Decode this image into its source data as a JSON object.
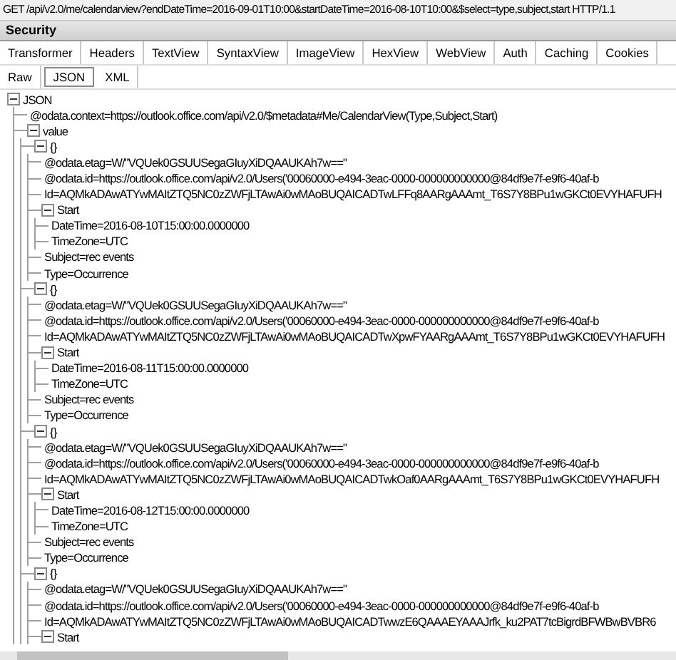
{
  "request_line": "GET /api/v2.0/me/calendarview?endDateTime=2016-09-01T10:00&startDateTime=2016-08-10T10:00&$select=type,subject,start HTTP/1.1",
  "section_header": "Security",
  "tabs": [
    {
      "label": "Transformer",
      "selected": false
    },
    {
      "label": "Headers",
      "selected": false
    },
    {
      "label": "TextView",
      "selected": false
    },
    {
      "label": "SyntaxView",
      "selected": false
    },
    {
      "label": "ImageView",
      "selected": false
    },
    {
      "label": "HexView",
      "selected": false
    },
    {
      "label": "WebView",
      "selected": false
    },
    {
      "label": "Auth",
      "selected": false
    },
    {
      "label": "Caching",
      "selected": false
    },
    {
      "label": "Cookies",
      "selected": false
    }
  ],
  "subtabs": [
    {
      "label": "Raw",
      "selected": false
    },
    {
      "label": "JSON",
      "selected": true
    },
    {
      "label": "XML",
      "selected": false
    }
  ],
  "tree": [
    {
      "label": "JSON",
      "expanded": true,
      "children": [
        {
          "label": "@odata.context=https://outlook.office.com/api/v2.0/$metadata#Me/CalendarView(Type,Subject,Start)"
        },
        {
          "label": "value",
          "expanded": true,
          "children": [
            {
              "label": "{}",
              "expanded": true,
              "children": [
                {
                  "label": "@odata.etag=W/\"VQUek0GSUUSegaGIuyXiDQAAUKAh7w==\""
                },
                {
                  "label": "@odata.id=https://outlook.office.com/api/v2.0/Users('00060000-e494-3eac-0000-000000000000@84df9e7f-e9f6-40af-b"
                },
                {
                  "label": "Id=AQMkADAwATYwMAItZTQ5NC0zZWFjLTAwAi0wMAoBUQAICADTwLFFq8AARgAAAmt_T6S7Y8BPu1wGKCt0EVYHAFUFH"
                },
                {
                  "label": "Start",
                  "expanded": true,
                  "children": [
                    {
                      "label": "DateTime=2016-08-10T15:00:00.0000000"
                    },
                    {
                      "label": "TimeZone=UTC"
                    }
                  ]
                },
                {
                  "label": "Subject=rec events"
                },
                {
                  "label": "Type=Occurrence"
                }
              ]
            },
            {
              "label": "{}",
              "expanded": true,
              "children": [
                {
                  "label": "@odata.etag=W/\"VQUek0GSUUSegaGIuyXiDQAAUKAh7w==\""
                },
                {
                  "label": "@odata.id=https://outlook.office.com/api/v2.0/Users('00060000-e494-3eac-0000-000000000000@84df9e7f-e9f6-40af-b"
                },
                {
                  "label": "Id=AQMkADAwATYwMAItZTQ5NC0zZWFjLTAwAi0wMAoBUQAICADTwXpwFYAARgAAAmt_T6S7Y8BPu1wGKCt0EVYHAFUFH"
                },
                {
                  "label": "Start",
                  "expanded": true,
                  "children": [
                    {
                      "label": "DateTime=2016-08-11T15:00:00.0000000"
                    },
                    {
                      "label": "TimeZone=UTC"
                    }
                  ]
                },
                {
                  "label": "Subject=rec events"
                },
                {
                  "label": "Type=Occurrence"
                }
              ]
            },
            {
              "label": "{}",
              "expanded": true,
              "children": [
                {
                  "label": "@odata.etag=W/\"VQUek0GSUUSegaGIuyXiDQAAUKAh7w==\""
                },
                {
                  "label": "@odata.id=https://outlook.office.com/api/v2.0/Users('00060000-e494-3eac-0000-000000000000@84df9e7f-e9f6-40af-b"
                },
                {
                  "label": "Id=AQMkADAwATYwMAItZTQ5NC0zZWFjLTAwAi0wMAoBUQAICADTwkOaf0AARgAAAmt_T6S7Y8BPu1wGKCt0EVYHAFUFH"
                },
                {
                  "label": "Start",
                  "expanded": true,
                  "children": [
                    {
                      "label": "DateTime=2016-08-12T15:00:00.0000000"
                    },
                    {
                      "label": "TimeZone=UTC"
                    }
                  ]
                },
                {
                  "label": "Subject=rec events"
                },
                {
                  "label": "Type=Occurrence"
                }
              ]
            },
            {
              "label": "{}",
              "expanded": true,
              "children": [
                {
                  "label": "@odata.etag=W/\"VQUek0GSUUSegaGIuyXiDQAAUKAh7w==\""
                },
                {
                  "label": "@odata.id=https://outlook.office.com/api/v2.0/Users('00060000-e494-3eac-0000-000000000000@84df9e7f-e9f6-40af-b"
                },
                {
                  "label": "Id=AQMkADAwATYwMAItZTQ5NC0zZWFjLTAwAi0wMAoBUQAICADTwwzE6QAAAEYAAAJrfk_ku2PAT7tcBigrdBFWBwBVBR6"
                },
                {
                  "label": "Start",
                  "expanded": true
                }
              ]
            }
          ]
        }
      ]
    }
  ]
}
